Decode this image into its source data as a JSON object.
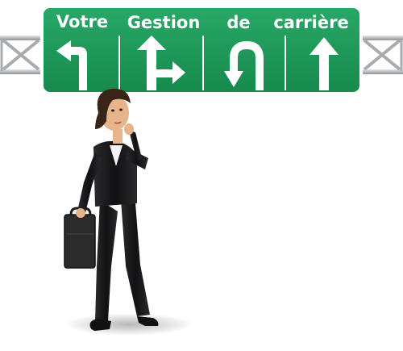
{
  "sign": {
    "words": [
      "Votre",
      "Gestion",
      "de",
      "carrière"
    ],
    "arrows": [
      "turn-left-arrow-icon",
      "straight-or-right-arrow-icon",
      "u-turn-arrow-icon",
      "straight-arrow-icon"
    ]
  },
  "colors": {
    "sign_green": "#1f9a5a",
    "sign_border": "#ffffff",
    "gantry_metal": "#b9bcc0",
    "suit": "#1a1a1c",
    "skin": "#e8b48a",
    "hair": "#3a2418"
  },
  "figure": {
    "description_icon": "thinking-businesswoman-with-briefcase"
  }
}
